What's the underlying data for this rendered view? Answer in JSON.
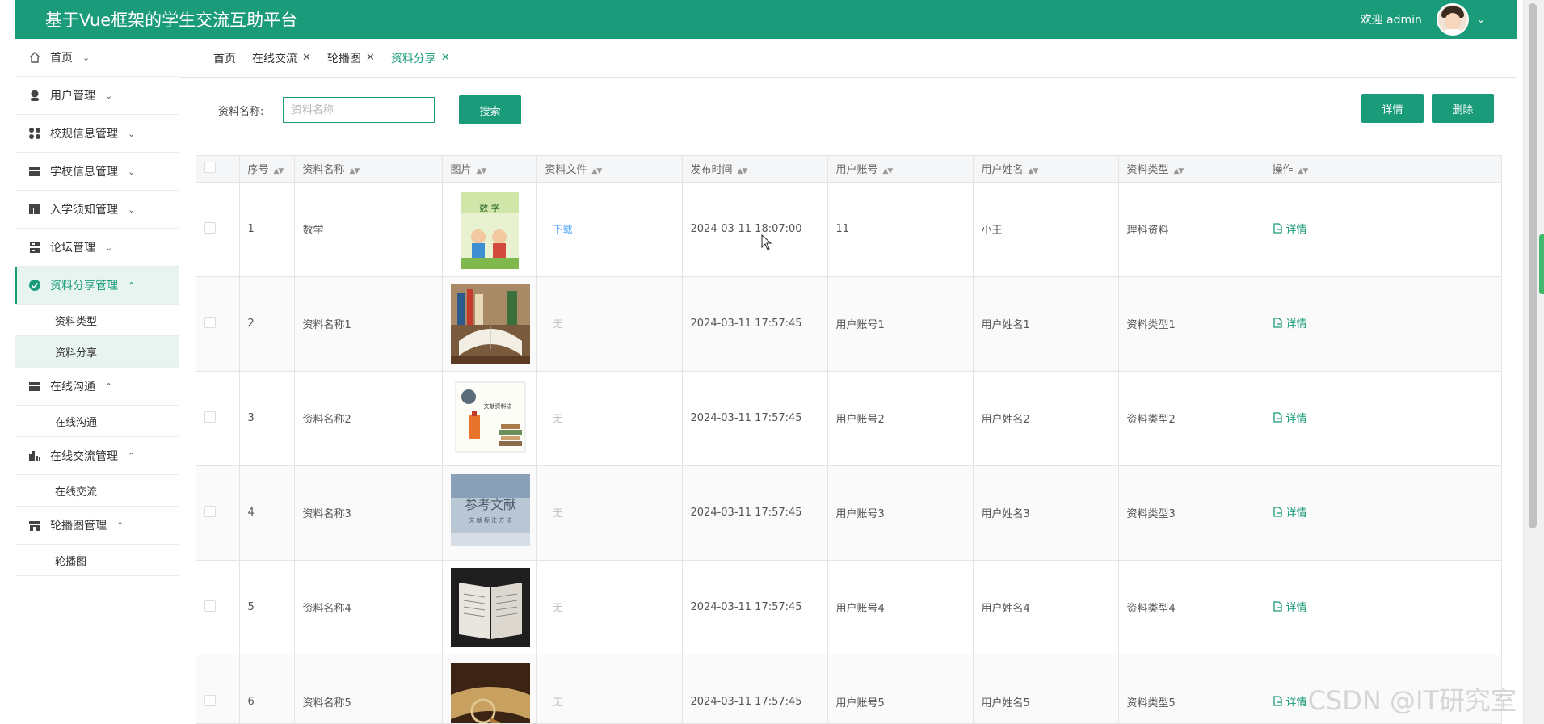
{
  "header": {
    "title": "基于Vue框架的学生交流互助平台",
    "welcome": "欢迎 admin"
  },
  "sidebar": {
    "items": [
      {
        "label": "首页",
        "icon": "home-icon",
        "arrow": "⌄"
      },
      {
        "label": "用户管理",
        "icon": "user-icon",
        "arrow": "⌄"
      },
      {
        "label": "校规信息管理",
        "icon": "grid-icon",
        "arrow": "⌄"
      },
      {
        "label": "学校信息管理",
        "icon": "card-icon",
        "arrow": "⌄"
      },
      {
        "label": "入学须知管理",
        "icon": "layout-icon",
        "arrow": "⌄"
      },
      {
        "label": "论坛管理",
        "icon": "server-icon",
        "arrow": "⌄"
      },
      {
        "label": "资料分享管理",
        "icon": "check-circle-icon",
        "arrow": "⌃"
      },
      {
        "label": "在线沟通",
        "icon": "card-icon",
        "arrow": "⌃"
      },
      {
        "label": "在线交流管理",
        "icon": "chart-icon",
        "arrow": "⌃"
      },
      {
        "label": "轮播图管理",
        "icon": "shop-icon",
        "arrow": "⌃"
      }
    ],
    "sub": {
      "share_type": "资料类型",
      "share": "资料分享",
      "chat": "在线沟通",
      "exchange": "在线交流",
      "carousel": "轮播图"
    }
  },
  "tabs": [
    {
      "label": "首页",
      "closable": false
    },
    {
      "label": "在线交流",
      "closable": true
    },
    {
      "label": "轮播图",
      "closable": true
    },
    {
      "label": "资料分享",
      "closable": true
    }
  ],
  "search": {
    "label": "资料名称:",
    "placeholder": "资料名称",
    "button": "搜索"
  },
  "actions": {
    "detail": "详情",
    "delete": "删除"
  },
  "table": {
    "columns": [
      "序号",
      "资料名称",
      "图片",
      "资料文件",
      "发布时间",
      "用户账号",
      "用户姓名",
      "资料类型",
      "操作"
    ],
    "rows": [
      {
        "index": "1",
        "name": "数学",
        "file": "下载",
        "time": "2024-03-11 18:07:00",
        "account": "11",
        "username": "小王",
        "type": "理科资料",
        "op": "详情"
      },
      {
        "index": "2",
        "name": "资料名称1",
        "file": "无",
        "time": "2024-03-11 17:57:45",
        "account": "用户账号1",
        "username": "用户姓名1",
        "type": "资料类型1",
        "op": "详情"
      },
      {
        "index": "3",
        "name": "资料名称2",
        "file": "无",
        "time": "2024-03-11 17:57:45",
        "account": "用户账号2",
        "username": "用户姓名2",
        "type": "资料类型2",
        "op": "详情"
      },
      {
        "index": "4",
        "name": "资料名称3",
        "file": "无",
        "time": "2024-03-11 17:57:45",
        "account": "用户账号3",
        "username": "用户姓名3",
        "type": "资料类型3",
        "op": "详情"
      },
      {
        "index": "5",
        "name": "资料名称4",
        "file": "无",
        "time": "2024-03-11 17:57:45",
        "account": "用户账号4",
        "username": "用户姓名4",
        "type": "资料类型4",
        "op": "详情"
      },
      {
        "index": "6",
        "name": "资料名称5",
        "file": "无",
        "time": "2024-03-11 17:57:45",
        "account": "用户账号5",
        "username": "用户姓名5",
        "type": "资料类型5",
        "op": "详情"
      }
    ],
    "thumb_texts": {
      "math_cover": "数 学",
      "doc_cover": "文献资料法",
      "ref_title": "参考文献",
      "ref_sub": "文 献 标 注 方 法"
    }
  },
  "watermark": "CSDN @IT研究室",
  "colors": {
    "primary": "#1a9b7a",
    "link": "#409eff"
  }
}
